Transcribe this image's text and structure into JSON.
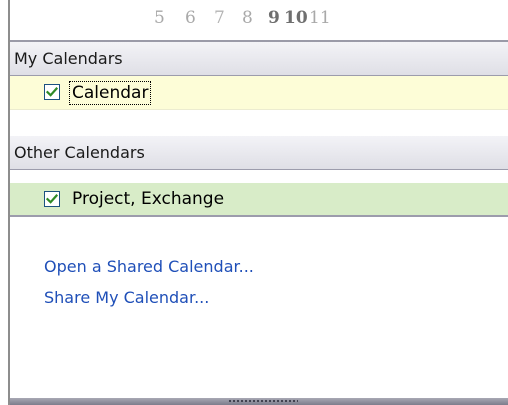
{
  "mini_calendar": {
    "days": [
      {
        "label": "5",
        "style": "normal"
      },
      {
        "label": "6",
        "style": "normal"
      },
      {
        "label": "7",
        "style": "light"
      },
      {
        "label": "8",
        "style": "normal"
      },
      {
        "label": "9",
        "style": "bold"
      },
      {
        "label": "10",
        "style": "bold"
      },
      {
        "label": "11",
        "style": "normal"
      }
    ]
  },
  "my_calendars": {
    "header": "My Calendars",
    "items": [
      {
        "label": "Calendar",
        "checked": true,
        "color": "#fdfdd7",
        "focused": true
      }
    ]
  },
  "other_calendars": {
    "header": "Other Calendars",
    "items": [
      {
        "label": "Project, Exchange",
        "checked": true,
        "color": "#d8ecc8"
      }
    ]
  },
  "links": {
    "open_shared": "Open a Shared Calendar...",
    "share_mine": "Share My Calendar..."
  },
  "colors": {
    "link": "#1f4fb8",
    "check": "#2f8a26",
    "checkbox_border": "#1c5180"
  }
}
